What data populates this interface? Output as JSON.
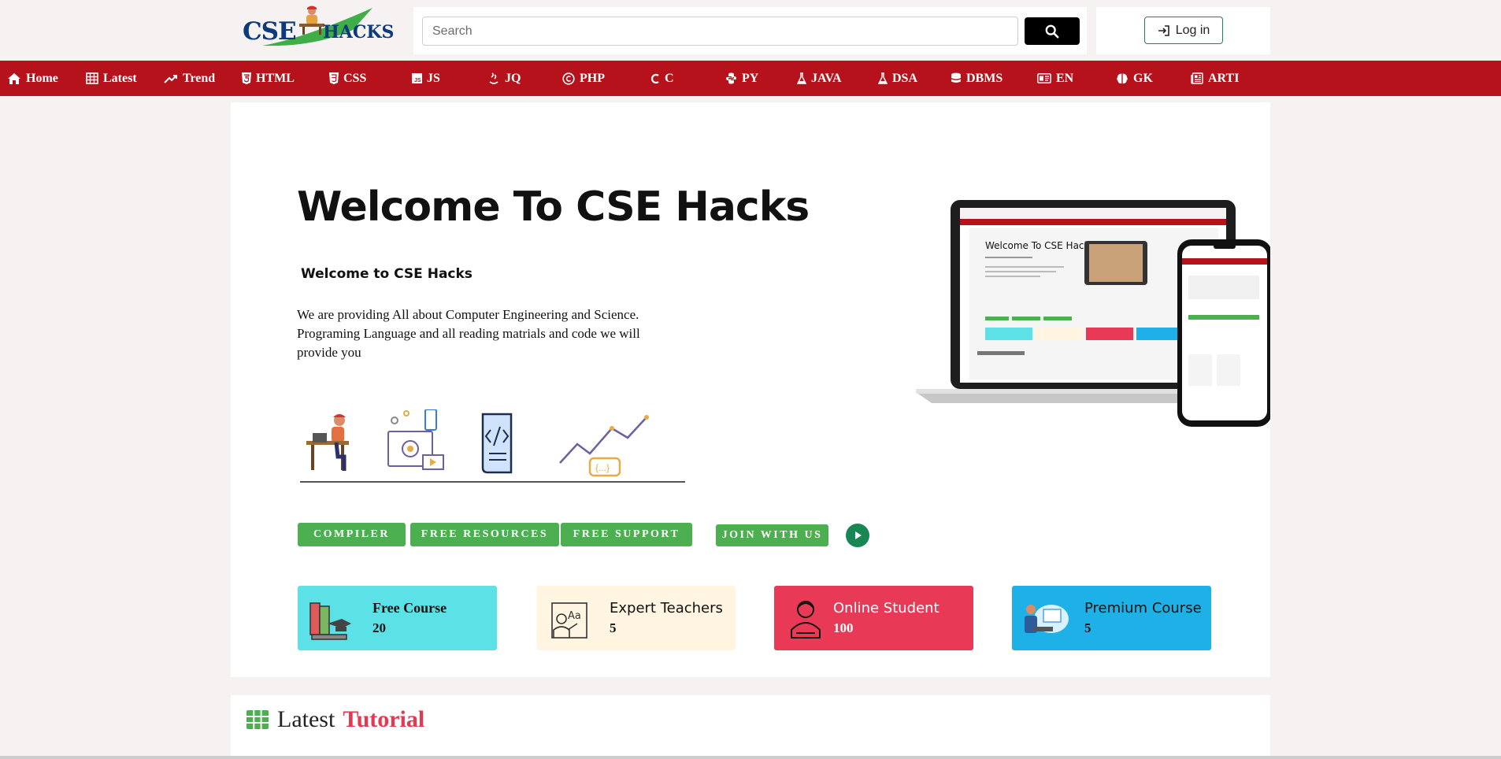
{
  "header": {
    "logo_text_1": "CSE",
    "logo_text_2": "HACKS",
    "search_placeholder": "Search",
    "search_icon": "search-icon",
    "login_label": "Log in",
    "login_icon": "sign-in-icon"
  },
  "nav": {
    "items": [
      {
        "label": "Home",
        "icon": "home-icon"
      },
      {
        "label": "Latest",
        "icon": "table-icon"
      },
      {
        "label": "Trend",
        "icon": "trend-icon"
      },
      {
        "label": "HTML",
        "icon": "html5-icon"
      },
      {
        "label": "CSS",
        "icon": "css3-icon"
      },
      {
        "label": "JS",
        "icon": "js-icon"
      },
      {
        "label": "JQ",
        "icon": "java-cup-icon"
      },
      {
        "label": "PHP",
        "icon": "copyright-icon"
      },
      {
        "label": "C",
        "icon": "c-icon"
      },
      {
        "label": "PY",
        "icon": "python-icon"
      },
      {
        "label": "JAVA",
        "icon": "flask-icon"
      },
      {
        "label": "DSA",
        "icon": "flask-icon"
      },
      {
        "label": "DBMS",
        "icon": "database-icon"
      },
      {
        "label": "EN",
        "icon": "id-card-icon"
      },
      {
        "label": "GK",
        "icon": "brain-icon"
      },
      {
        "label": "ARTI",
        "icon": "newspaper-icon"
      }
    ],
    "background": "#b5121b"
  },
  "hero": {
    "title": "Welcome To CSE Hacks",
    "subtitle": "Welcome to CSE Hacks",
    "description": "We are providing All about Computer Engineering and Science. Programing Language  and all reading matrials and code we will provide you",
    "buttons": [
      "COMPILER",
      "FREE RESOURCES",
      "FREE SUPPORT",
      "JOIN WITH US"
    ],
    "play_icon": "play-icon",
    "button_color": "#4caf50"
  },
  "stats": [
    {
      "title": "Free Course",
      "value": "20",
      "bg": "#5ce1e6",
      "icon": "books-graduation-icon"
    },
    {
      "title": "Expert Teachers",
      "value": "5",
      "bg": "#fff5e1",
      "icon": "teacher-board-icon"
    },
    {
      "title": "Online Student",
      "value": "100",
      "bg": "#e83a57",
      "icon": "student-icon"
    },
    {
      "title": "Premium Course",
      "value": "5",
      "bg": "#1eb1e8",
      "icon": "premium-course-icon"
    }
  ],
  "latest": {
    "prefix": "Latest",
    "accent": "Tutorial",
    "icon": "grid-table-icon"
  }
}
